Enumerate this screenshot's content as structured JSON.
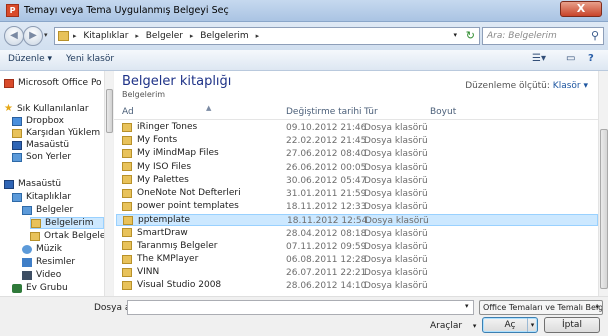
{
  "window": {
    "title": "Temayı veya Tema Uygulanmış Belgeyi Seç",
    "close_label": "X"
  },
  "address": {
    "crumbs": [
      "Kitaplıklar",
      "Belgeler",
      "Belgelerim"
    ],
    "search_placeholder": "Ara: Belgelerim"
  },
  "toolbar": {
    "organize_label": "Düzenle ▾",
    "new_folder_label": "Yeni klasör"
  },
  "nav": {
    "items": [
      {
        "label": "Microsoft Office Po",
        "icon": "office-icon"
      },
      {
        "label": "Sık Kullanılanlar",
        "icon": "star-icon"
      },
      {
        "label": "Dropbox",
        "icon": "dropbox-icon"
      },
      {
        "label": "Karşıdan Yüklem",
        "icon": "download-folder-icon"
      },
      {
        "label": "Masaüstü",
        "icon": "desktop-icon"
      },
      {
        "label": "Son Yerler",
        "icon": "recent-places-icon"
      },
      {
        "label": "Masaüstü",
        "icon": "desktop-icon"
      },
      {
        "label": "Kitaplıklar",
        "icon": "libraries-icon"
      },
      {
        "label": "Belgeler",
        "icon": "documents-icon"
      },
      {
        "label": "Belgelerim",
        "icon": "folder-icon"
      },
      {
        "label": "Ortak Belgele",
        "icon": "folder-icon"
      },
      {
        "label": "Müzik",
        "icon": "music-icon"
      },
      {
        "label": "Resimler",
        "icon": "pictures-icon"
      },
      {
        "label": "Video",
        "icon": "video-icon"
      },
      {
        "label": "Ev Grubu",
        "icon": "homegroup-icon"
      }
    ]
  },
  "library": {
    "title": "Belgeler kitaplığı",
    "subtitle": "Belgelerim",
    "arrange_label": "Düzenleme ölçütü:",
    "arrange_value": "Klasör ▾"
  },
  "columns": {
    "name": "Ad",
    "date": "Değiştirme tarihi",
    "type": "Tür",
    "size": "Boyut"
  },
  "files": [
    {
      "name": "iRinger Tones",
      "date": "09.10.2012 21:46",
      "type": "Dosya klasörü"
    },
    {
      "name": "My Fonts",
      "date": "22.02.2012 21:45",
      "type": "Dosya klasörü"
    },
    {
      "name": "My iMindMap Files",
      "date": "27.06.2012 08:40",
      "type": "Dosya klasörü"
    },
    {
      "name": "My ISO Files",
      "date": "26.06.2012 00:05",
      "type": "Dosya klasörü"
    },
    {
      "name": "My Palettes",
      "date": "30.06.2012 05:47",
      "type": "Dosya klasörü"
    },
    {
      "name": "OneNote Not Defterleri",
      "date": "31.01.2011 21:59",
      "type": "Dosya klasörü"
    },
    {
      "name": "power point templates",
      "date": "18.11.2012 12:33",
      "type": "Dosya klasörü"
    },
    {
      "name": "pptemplate",
      "date": "18.11.2012 12:54",
      "type": "Dosya klasörü"
    },
    {
      "name": "SmartDraw",
      "date": "28.04.2012 08:18",
      "type": "Dosya klasörü"
    },
    {
      "name": "Taranmış Belgeler",
      "date": "07.11.2012 09:59",
      "type": "Dosya klasörü"
    },
    {
      "name": "The KMPlayer",
      "date": "06.08.2011 12:28",
      "type": "Dosya klasörü"
    },
    {
      "name": "VINN",
      "date": "26.07.2011 22:21",
      "type": "Dosya klasörü"
    },
    {
      "name": "Visual Studio 2008",
      "date": "28.06.2012 14:10",
      "type": "Dosya klasörü"
    }
  ],
  "bottom": {
    "filename_label": "Dosya adı:",
    "filename_value": "",
    "filter_value": "Office Temaları ve Temalı Belge",
    "tools_label": "Araçlar",
    "open_label": "Aç",
    "cancel_label": "İptal"
  }
}
